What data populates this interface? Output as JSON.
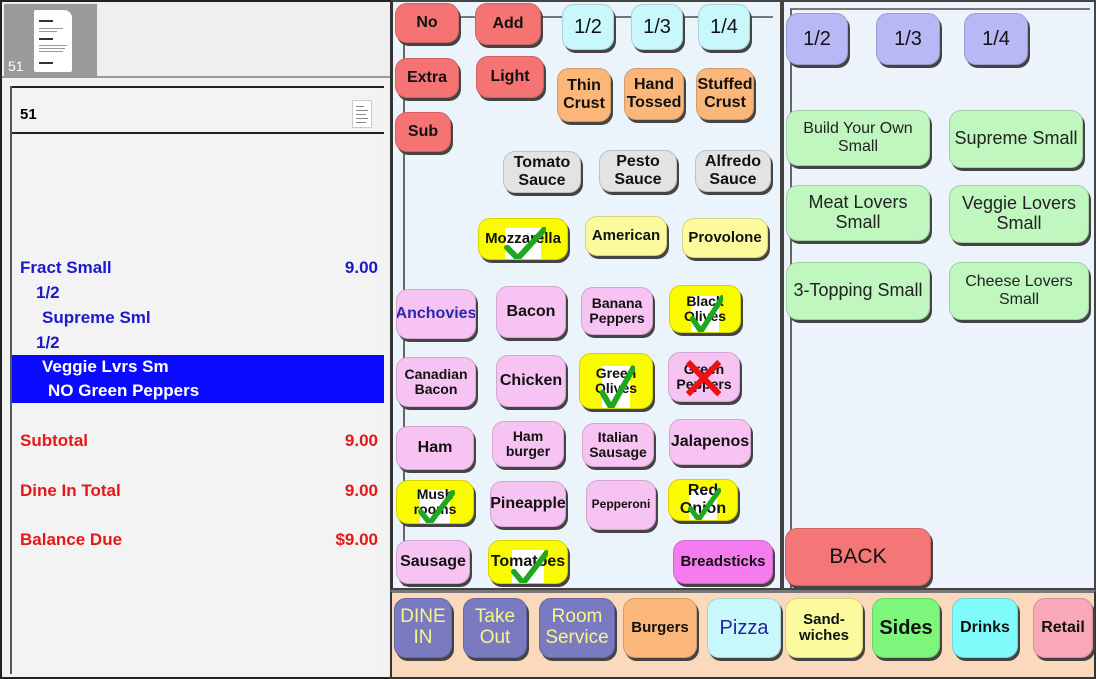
{
  "order_tab": {
    "number": "51",
    "icon": "receipt-icon"
  },
  "ticket": {
    "number": "51",
    "icon": "receipt-icon",
    "items": [
      {
        "text": "Fract Small",
        "price": "9.00",
        "indent": 0
      },
      {
        "text": "1/2",
        "price": "",
        "indent": 1
      },
      {
        "text": "Supreme Sml",
        "price": "",
        "indent": 2
      },
      {
        "text": "1/2",
        "price": "",
        "indent": 1
      },
      {
        "text": "Veggie Lvrs Sm",
        "price": "",
        "indent": 2,
        "selected": true
      },
      {
        "text": "NO Green Peppers",
        "price": "",
        "indent": 3,
        "selected": true
      }
    ],
    "totals": [
      {
        "label": "Subtotal",
        "value": "9.00"
      },
      {
        "label": "Dine In Total",
        "value": "9.00"
      },
      {
        "label": "Balance Due",
        "value": "$9.00"
      }
    ]
  },
  "modifiers": {
    "actions": [
      "No",
      "Add",
      "Extra",
      "Light",
      "Sub"
    ],
    "fractions": [
      "1/2",
      "1/3",
      "1/4"
    ],
    "crusts": [
      "Thin Crust",
      "Hand Tossed",
      "Stuffed Crust"
    ],
    "sauces": [
      "Tomato Sauce",
      "Pesto Sauce",
      "Alfredo Sauce"
    ],
    "cheeses": [
      {
        "label": "Mozzarella",
        "state": "checked"
      },
      {
        "label": "American",
        "state": "off"
      },
      {
        "label": "Provolone",
        "state": "off"
      }
    ],
    "toppings": [
      {
        "label": "Anchovies",
        "state": "off"
      },
      {
        "label": "Bacon",
        "state": "off"
      },
      {
        "label": "Banana Peppers",
        "state": "off"
      },
      {
        "label": "Black Olives",
        "state": "checked"
      },
      {
        "label": "Canadian Bacon",
        "state": "off"
      },
      {
        "label": "Chicken",
        "state": "off"
      },
      {
        "label": "Green Olives",
        "state": "checked"
      },
      {
        "label": "Green Peppers",
        "state": "removed"
      },
      {
        "label": "Ham",
        "state": "off"
      },
      {
        "label": "Ham burger",
        "state": "off"
      },
      {
        "label": "Italian Sausage",
        "state": "off"
      },
      {
        "label": "Jalapenos",
        "state": "off"
      },
      {
        "label": "Mush rooms",
        "state": "checked"
      },
      {
        "label": "Pineapple",
        "state": "off"
      },
      {
        "label": "Pepperoni",
        "state": "off"
      },
      {
        "label": "Red Onion",
        "state": "checked"
      },
      {
        "label": "Sausage",
        "state": "off"
      },
      {
        "label": "Tomatoes",
        "state": "checked"
      }
    ],
    "breadsticks": "Breadsticks"
  },
  "pizza_panel": {
    "fractions": [
      "1/2",
      "1/3",
      "1/4"
    ],
    "pizzas": [
      "Build Your Own Small",
      "Supreme Small",
      "Meat Lovers Small",
      "Veggie Lovers Small",
      "3-Topping Small",
      "Cheese Lovers Small"
    ],
    "back": "BACK"
  },
  "categories": [
    {
      "label": "DINE IN"
    },
    {
      "label": "Take Out"
    },
    {
      "label": "Room Service"
    },
    {
      "label": "Burgers"
    },
    {
      "label": "Pizza"
    },
    {
      "label": "Sand- wiches"
    },
    {
      "label": "Sides"
    },
    {
      "label": "Drinks"
    },
    {
      "label": "Retail"
    }
  ],
  "colors": {
    "selected_row": "#0a0aff",
    "order_text": "#1a1acc",
    "total_text": "#e61717",
    "check": "#1fa81f",
    "remove": "#ee1111"
  }
}
